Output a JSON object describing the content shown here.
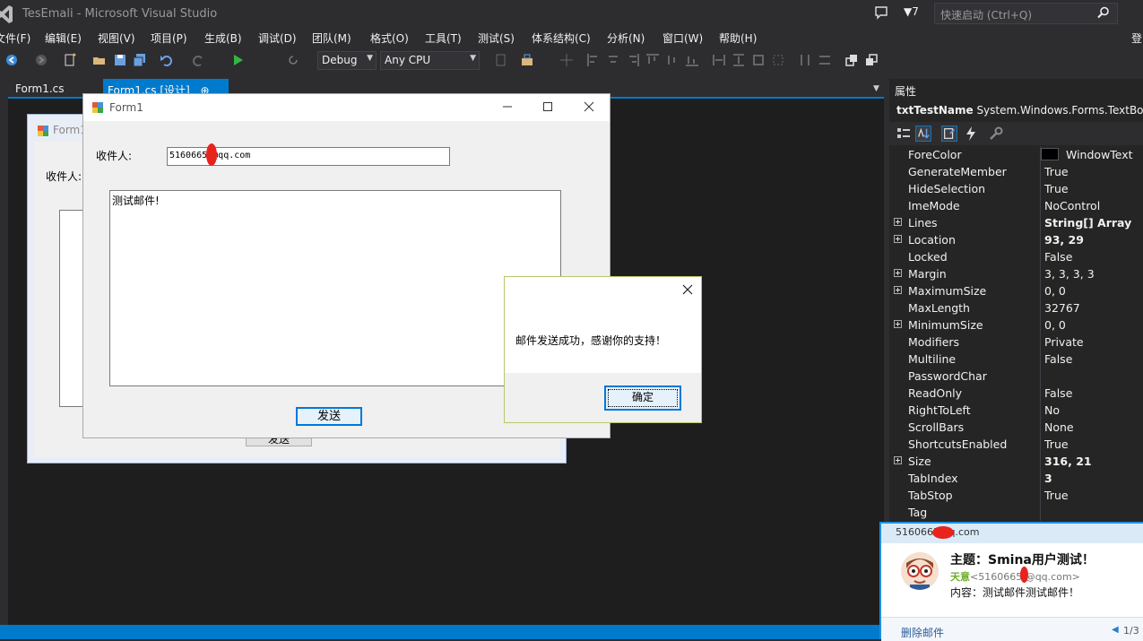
{
  "window": {
    "title": "TesEmali - Microsoft Visual Studio",
    "notification_count": "7",
    "quick_launch_placeholder": "快速启动 (Ctrl+Q)",
    "login_label": "登"
  },
  "menu": [
    "文件(F)",
    "编辑(E)",
    "视图(V)",
    "项目(P)",
    "生成(B)",
    "调试(D)",
    "团队(M)",
    "格式(O)",
    "工具(T)",
    "测试(S)",
    "体系结构(C)",
    "分析(N)",
    "窗口(W)",
    "帮助(H)"
  ],
  "toolbar": {
    "start_label": "启动",
    "config": "Debug",
    "platform": "Any CPU"
  },
  "tabs": {
    "tab1": "Form1.cs",
    "tab2": "Form1.cs [设计]",
    "tab2_pin": "⊕",
    "tab2_close": "×"
  },
  "designer_form": {
    "title": "Form1",
    "label": "收件人:",
    "button": "发送"
  },
  "form1": {
    "title": "Form1",
    "recipient_label": "收件人:",
    "recipient_value": "5160665  @qq.com",
    "body_value": "测试邮件!",
    "send_label": "发送"
  },
  "messagebox": {
    "text": "邮件发送成功，感谢你的支持！",
    "ok_label": "确定"
  },
  "properties": {
    "title": "属性",
    "object_name": "txtTestName",
    "object_type": "System.Windows.Forms.TextBox",
    "rows": [
      {
        "name": "ForeColor",
        "value": "WindowText"
      },
      {
        "name": "GenerateMember",
        "value": "True"
      },
      {
        "name": "HideSelection",
        "value": "True"
      },
      {
        "name": "ImeMode",
        "value": "NoControl"
      },
      {
        "name": "Lines",
        "value": "String[] Array"
      },
      {
        "name": "Location",
        "value": "93, 29"
      },
      {
        "name": "Locked",
        "value": "False"
      },
      {
        "name": "Margin",
        "value": "3, 3, 3, 3"
      },
      {
        "name": "MaximumSize",
        "value": "0, 0"
      },
      {
        "name": "MaxLength",
        "value": "32767"
      },
      {
        "name": "MinimumSize",
        "value": "0, 0"
      },
      {
        "name": "Modifiers",
        "value": "Private"
      },
      {
        "name": "Multiline",
        "value": "False"
      },
      {
        "name": "PasswordChar",
        "value": ""
      },
      {
        "name": "ReadOnly",
        "value": "False"
      },
      {
        "name": "RightToLeft",
        "value": "No"
      },
      {
        "name": "ScrollBars",
        "value": "None"
      },
      {
        "name": "ShortcutsEnabled",
        "value": "True"
      },
      {
        "name": "Size",
        "value": "316, 21"
      },
      {
        "name": "TabIndex",
        "value": "3"
      },
      {
        "name": "TabStop",
        "value": "True"
      },
      {
        "name": "Tag",
        "value": ""
      }
    ]
  },
  "toast": {
    "account": "5160665    qq.com",
    "subject": "主题：Smina用户测试！",
    "sender_name": "天意",
    "sender_addr": "<5160665  @qq.com>",
    "content": "内容：测试邮件测试邮件！",
    "delete_label": "删除邮件",
    "prev_icon": "◀",
    "page": "1/3"
  }
}
